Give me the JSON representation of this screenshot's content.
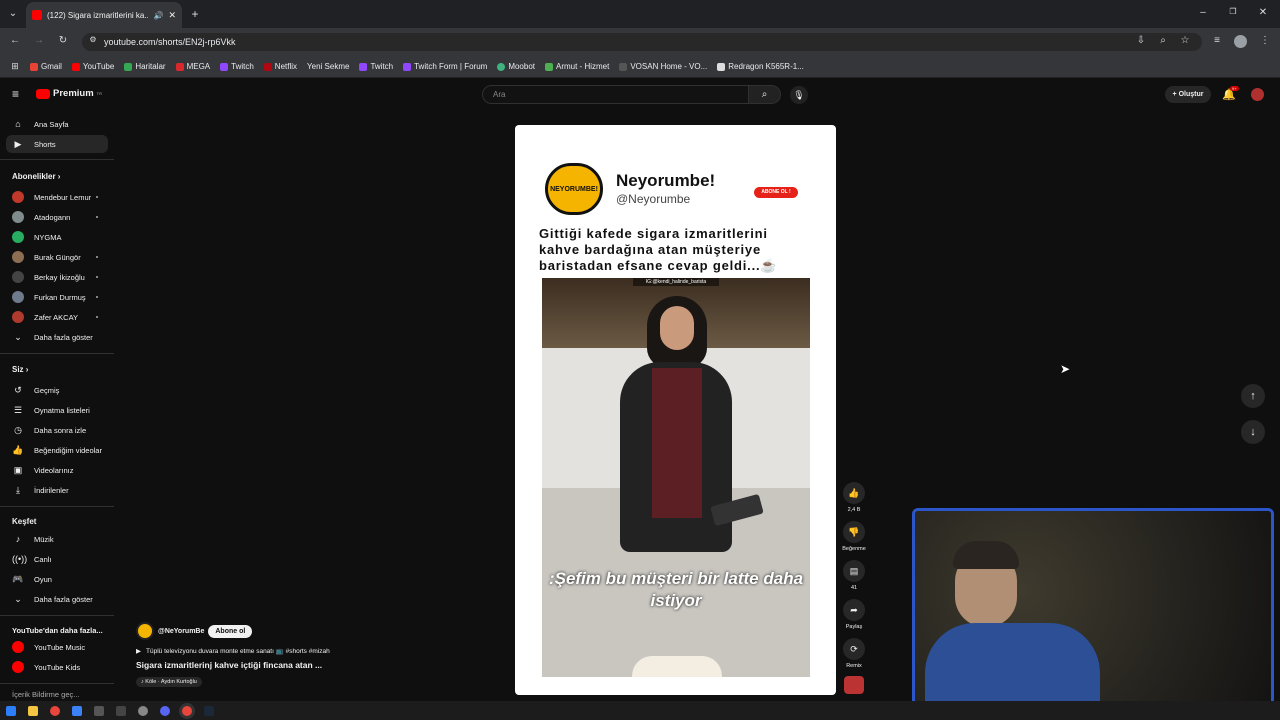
{
  "browser": {
    "tab_title": "(122) Sigara izmaritlerini ka...",
    "url": "youtube.com/shorts/EN2j-rp6Vkk",
    "bookmarks": [
      "Gmail",
      "YouTube",
      "Haritalar",
      "MEGA",
      "Twitch",
      "Netflix",
      "Yeni Sekme",
      "Twitch",
      "Twitch Form | Forum",
      "Moobot",
      "Armut - Hizmet",
      "VOSAN Home - VO...",
      "Redragon K565R-1..."
    ]
  },
  "header": {
    "logo": "Premium",
    "logo_sup": "TR",
    "search_placeholder": "Ara",
    "create_label": "Oluştur",
    "notif_badge": "9+"
  },
  "sidebar": {
    "home": "Ana Sayfa",
    "shorts": "Shorts",
    "subs_title": "Abonelikler",
    "subs": [
      {
        "name": "Mendebur Lemur",
        "color": "#c0392b"
      },
      {
        "name": "Atadogann",
        "color": "#7f8c8d"
      },
      {
        "name": "NYGMA",
        "color": "#27ae60"
      },
      {
        "name": "Burak Güngör",
        "color": "#8e6e53"
      },
      {
        "name": "Berkay İkizoğlu",
        "color": "#444"
      },
      {
        "name": "Furkan Durmuş",
        "color": "#6d7b8d"
      },
      {
        "name": "Zafer AKCAY",
        "color": "#b03a2e"
      }
    ],
    "show_more": "Daha fazla göster",
    "you_title": "Siz",
    "you": [
      "Geçmiş",
      "Oynatma listeleri",
      "Daha sonra izle",
      "Beğendiğim videolar",
      "Videolarınız",
      "İndirilenler"
    ],
    "explore_title": "Keşfet",
    "explore": [
      "Müzik",
      "Canlı",
      "Oyun"
    ],
    "explore_more": "Daha fazla göster",
    "more_title": "YouTube'dan daha fazla...",
    "more": [
      "YouTube Music",
      "YouTube Kids"
    ],
    "cut": "İçerik Bildirme geç..."
  },
  "short": {
    "channel_name": "Neyorumbe!",
    "channel_handle": "@Neyorumbe",
    "logo_text": "NEYORUMBE!",
    "subscribe_tag": "ABONE OL !",
    "caption": "Gittiği kafede sigara izmaritlerini kahve bardağına atan müşteriye baristadan efsane cevap geldi...☕",
    "ig_tag": "IG:@kendi_halinde_barista",
    "overlay": ":Şefim bu müşteri bir latte daha istiyor",
    "likes": "2,4 B",
    "dislike_label": "Beğenme",
    "comments": "41",
    "share_label": "Paylaş",
    "remix_label": "Remix",
    "meta_channel": "@NeYorumBe",
    "meta_subscribe": "Abone ol",
    "meta_related": "Tüplü televizyonu duvara monte etme sanatı 📺 #shorts #mizah",
    "meta_title": "Sigara izmaritlerinj kahve içtiği fincana atan ...",
    "meta_music": "Köle · Aydın Kurtoğlu"
  }
}
